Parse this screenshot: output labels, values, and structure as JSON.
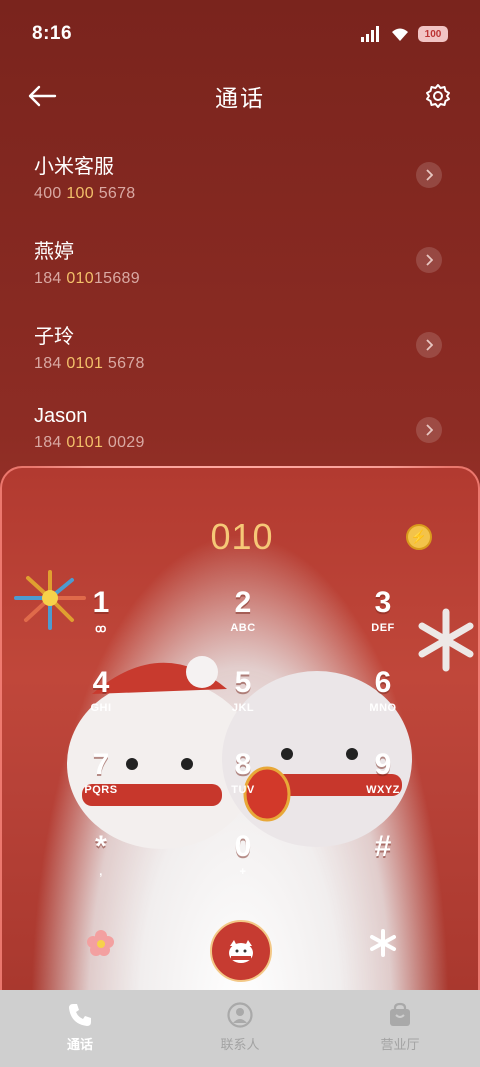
{
  "status_bar": {
    "time": "8:16",
    "battery": "100"
  },
  "header": {
    "title": "通话"
  },
  "suggestions": [
    {
      "name": "小米客服",
      "number_parts": [
        "400 ",
        "100",
        " 5678"
      ]
    },
    {
      "name": "燕婷",
      "number_parts": [
        "184 ",
        "010",
        "15689"
      ]
    },
    {
      "name": "子玲",
      "number_parts": [
        "184 ",
        "0101",
        " 5678"
      ]
    },
    {
      "name": "Jason",
      "number_parts": [
        "184 ",
        "0101",
        " 0029"
      ]
    }
  ],
  "dialpad": {
    "input": "010",
    "keys": [
      {
        "digit": "1",
        "letters": "ꝏ"
      },
      {
        "digit": "2",
        "letters": "ABC"
      },
      {
        "digit": "3",
        "letters": "DEF"
      },
      {
        "digit": "4",
        "letters": "GHI"
      },
      {
        "digit": "5",
        "letters": "JKL"
      },
      {
        "digit": "6",
        "letters": "MNO"
      },
      {
        "digit": "7",
        "letters": "PQRS"
      },
      {
        "digit": "8",
        "letters": "TUV"
      },
      {
        "digit": "9",
        "letters": "WXYZ"
      },
      {
        "digit": "*",
        "letters": ","
      },
      {
        "digit": "0",
        "letters": "+"
      },
      {
        "digit": "#",
        "letters": ""
      }
    ]
  },
  "bottom_nav": [
    {
      "label": "通话",
      "icon": "phone-icon",
      "active": true
    },
    {
      "label": "联系人",
      "icon": "contact-icon",
      "active": false
    },
    {
      "label": "营业厅",
      "icon": "store-icon",
      "active": false
    }
  ],
  "colors": {
    "highlight": "#f3c06a",
    "accent": "#c63b31"
  }
}
